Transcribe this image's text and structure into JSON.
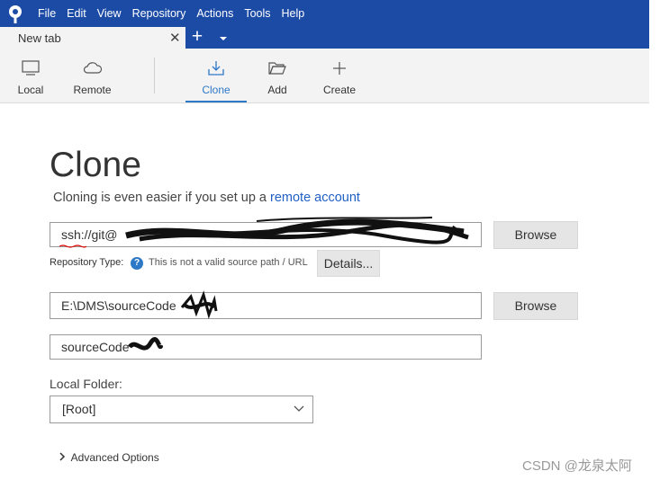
{
  "menu": [
    "File",
    "Edit",
    "View",
    "Repository",
    "Actions",
    "Tools",
    "Help"
  ],
  "tab": {
    "label": "New tab",
    "close": "✕",
    "add": "+"
  },
  "toolbar": {
    "local": "Local",
    "remote": "Remote",
    "clone": "Clone",
    "add": "Add",
    "create": "Create"
  },
  "clone": {
    "title": "Clone",
    "subtitle_prefix": "Cloning is even easier if you set up a ",
    "subtitle_link": "remote account",
    "source_url": "ssh://git@",
    "repo_type_label": "Repository Type:",
    "invalid_text": "This is not a valid source path / URL",
    "details_button": "Details...",
    "browse_button_1": "Browse",
    "destination_path": "E:\\DMS\\sourceCode",
    "browse_button_2": "Browse",
    "name": "sourceCode",
    "local_folder_label": "Local Folder:",
    "local_folder_value": "[Root]",
    "advanced_options": "Advanced Options"
  },
  "watermark": "CSDN @龙泉太阿",
  "colors": {
    "titlebar": "#1c4ba6",
    "accent": "#2e78c8",
    "link": "#2160c4"
  },
  "icons": [
    "sourcetree-logo-icon",
    "monitor-icon",
    "cloud-icon",
    "download-icon",
    "folder-open-icon",
    "plus-icon",
    "help-icon",
    "chevron-down-icon",
    "chevron-right-icon"
  ]
}
